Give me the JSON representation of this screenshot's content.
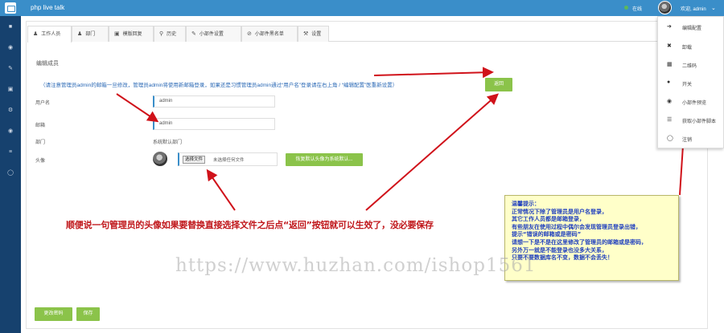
{
  "header": {
    "app_title": "php live talk",
    "online_label": "在线",
    "user_label": "欢迎, admin"
  },
  "tabs": [
    {
      "label": "工作人员",
      "icon": "user-icon"
    },
    {
      "label": "部门",
      "icon": "users-icon"
    },
    {
      "label": "模版回复",
      "icon": "comments-icon"
    },
    {
      "label": "历史",
      "icon": "search-icon"
    },
    {
      "label": "小部件设置",
      "icon": "pencil-icon"
    },
    {
      "label": "小部件黑名单",
      "icon": "ban-icon"
    },
    {
      "label": "设置",
      "icon": "wrench-icon"
    }
  ],
  "form": {
    "section_title": "编辑成员",
    "notice": "（请注意管理员admin的邮箱一旦修改，管理员admin将使用新邮箱登录，如果还是习惯管理员admin通过“用户名”登录请在右上角 / “编辑配置”医重新设置）",
    "username_label": "用户名",
    "username_value": "admin",
    "email_label": "邮箱",
    "email_value": "admin",
    "dept_label": "部门",
    "dept_value": "系统默认部门",
    "avatar_label": "头像",
    "file_button": "选择文件",
    "file_status": "未选择任何文件",
    "restore_button": "恢复默认头像为系统默认...",
    "back_button": "返回",
    "change_password_button": "更改密码",
    "save_button": "保存"
  },
  "annotation": {
    "red_note": "顺便说一句管理员的头像如果要替换直接选择文件之后点“返回”按钮就可以生效了，没必要保存",
    "tip_lines": [
      "温馨提示：",
      "正常情况下除了管理员是用户名登录，",
      "其它工作人员都是邮箱登录，",
      "有些朋友在使用过程中偶尔会发现管理员登录出错，",
      "提示“错误的邮箱或是密码”",
      "请想一下是不是在这里修改了管理员的邮箱或是密码，",
      "另外万一就是不能登录也没多大关系，",
      "只要不要数据库名不变，数据不会丢失！"
    ]
  },
  "menu": [
    {
      "label": "编辑配置",
      "icon": "arrow-right-icon"
    },
    {
      "label": "卸载",
      "icon": "close-icon"
    },
    {
      "label": "二维码",
      "icon": "qrcode-icon"
    },
    {
      "label": "开关",
      "icon": "power-icon"
    },
    {
      "label": "小部件预览",
      "icon": "eye-icon"
    },
    {
      "label": "获取小部件脚本",
      "icon": "code-icon"
    },
    {
      "label": "注销",
      "icon": "logout-icon"
    }
  ],
  "watermark": "https://www.huzhan.com/ishop1561",
  "colors": {
    "topbar": "#3a8ec9",
    "sidebar": "#16416e",
    "button_green": "#8bc34a",
    "annotation_red": "#c0171b",
    "tip_blue": "#1f3fbe",
    "tip_background": "#ffffc9"
  }
}
